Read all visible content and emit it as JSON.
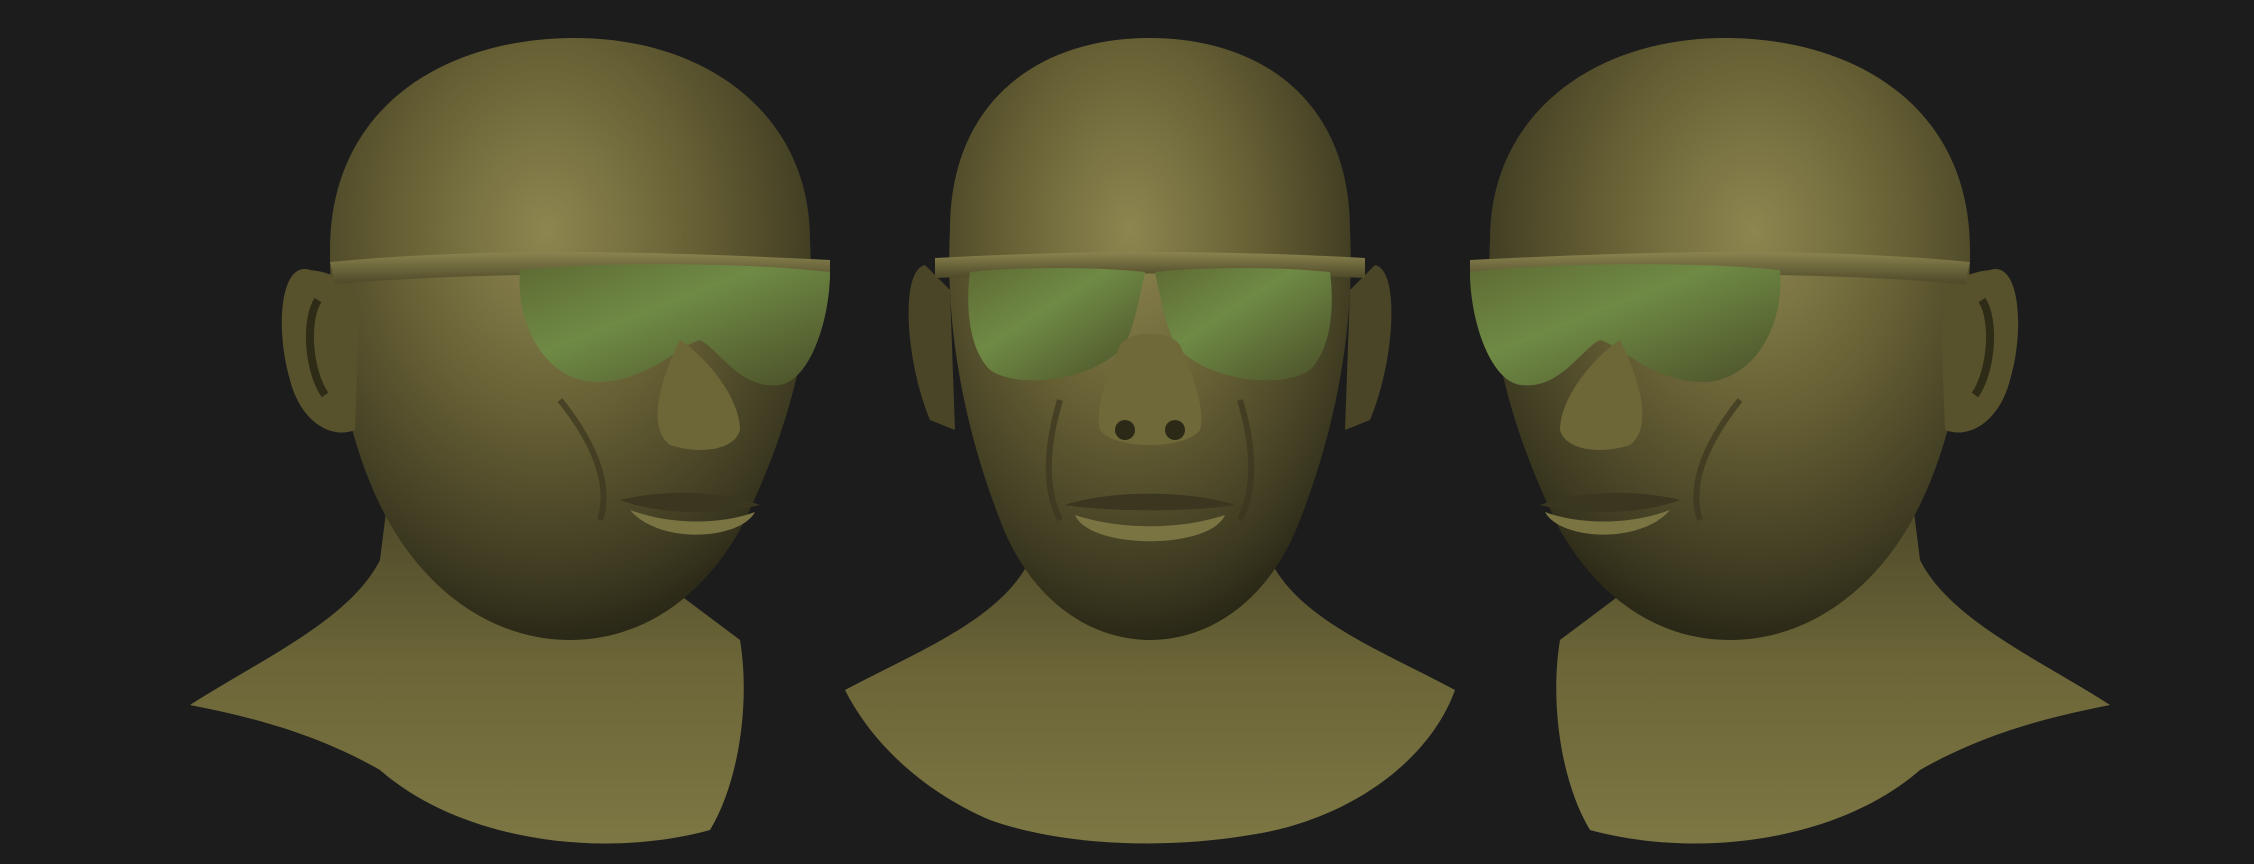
{
  "scene": {
    "background": "#1c1c1c",
    "clay_base": "#5e5a30",
    "clay_highlight": "#8e8850",
    "clay_shadow": "#2e2c17",
    "lens_tint": "#5a7a3a"
  },
  "views": [
    {
      "view": "three-quarter-left"
    },
    {
      "view": "front"
    },
    {
      "view": "three-quarter-right"
    }
  ]
}
